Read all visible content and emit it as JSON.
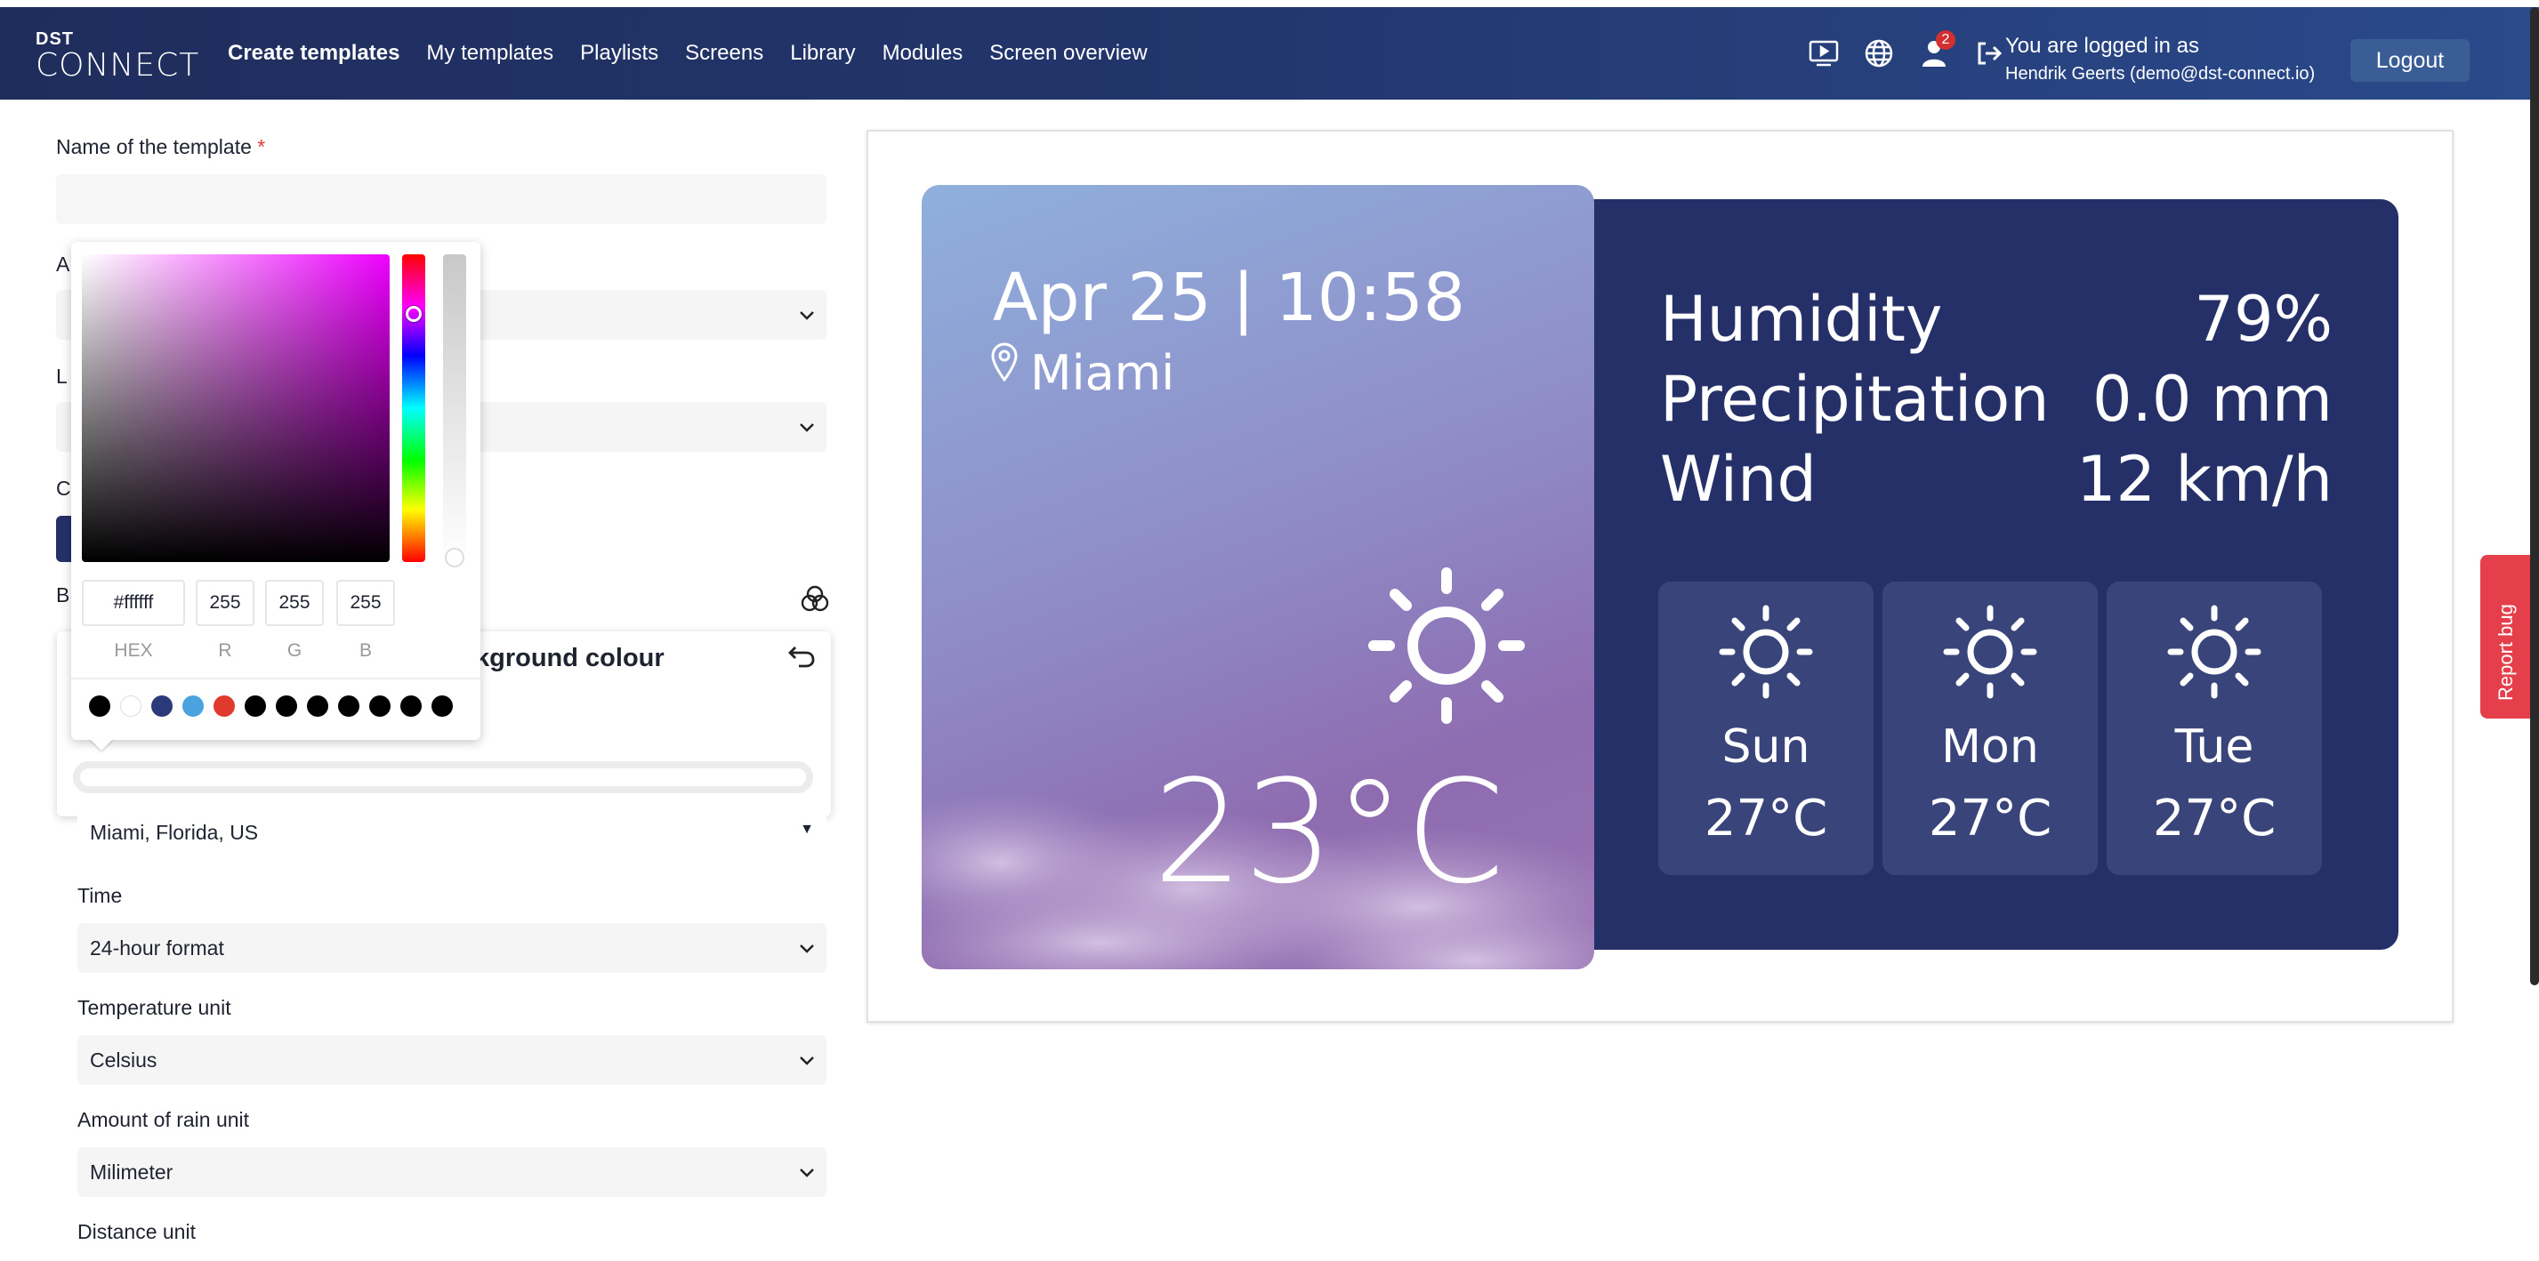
{
  "brand": {
    "small": "DST",
    "big": "CONNECT"
  },
  "nav": {
    "items": [
      {
        "label": "Create templates"
      },
      {
        "label": "My templates"
      },
      {
        "label": "Playlists"
      },
      {
        "label": "Screens"
      },
      {
        "label": "Library"
      },
      {
        "label": "Modules"
      },
      {
        "label": "Screen overview"
      }
    ],
    "notification_count": "2",
    "logged_in_line": "You are logged in as",
    "user_line": "Hendrik Geerts (demo@dst-connect.io)",
    "logout": "Logout"
  },
  "form": {
    "template_name_label": "Name of the template",
    "required_mark": "*",
    "template_name_value": "",
    "clipped_label_1": "A",
    "clipped_label_2": "L",
    "clipped_label_3": "C",
    "clipped_label_4": "B",
    "location_value": "Miami, Florida, US",
    "time_label": "Time",
    "time_value": "24-hour format",
    "temperature_unit_label": "Temperature unit",
    "temperature_unit_value": "Celsius",
    "rain_unit_label": "Amount of rain unit",
    "rain_unit_value": "Milimeter",
    "distance_unit_label": "Distance unit"
  },
  "background_popover": {
    "title": "kground colour"
  },
  "color_picker": {
    "hex": "#ffffff",
    "r": "255",
    "g": "255",
    "b": "255",
    "labels": {
      "hex": "HEX",
      "r": "R",
      "g": "G",
      "b": "B"
    },
    "swatches": [
      "#000000",
      "#ffffff",
      "#2b3a7a",
      "#4aa3df",
      "#e03a2e",
      "#000000",
      "#000000",
      "#000000",
      "#000000",
      "#000000",
      "#000000",
      "#000000"
    ]
  },
  "preview": {
    "date_time": "Apr 25 | 10:58",
    "city": "Miami",
    "temperature": "23°C",
    "stats": [
      {
        "label": "Humidity",
        "value": "79%"
      },
      {
        "label": "Precipitation",
        "value": "0.0 mm"
      },
      {
        "label": "Wind",
        "value": "12 km/h"
      }
    ],
    "forecast": [
      {
        "day": "Sun",
        "temp": "27°C"
      },
      {
        "day": "Mon",
        "temp": "27°C"
      },
      {
        "day": "Tue",
        "temp": "27°C"
      }
    ],
    "colors": {
      "left_panel": "#8f8cc8",
      "right_panel": "#253068",
      "day_card": "#39457a"
    }
  },
  "report_bug": "Report bug",
  "colors": {
    "nav_bg": "#22356b",
    "logout_bg": "#3a5d96",
    "report_bg": "#e53f4c"
  }
}
